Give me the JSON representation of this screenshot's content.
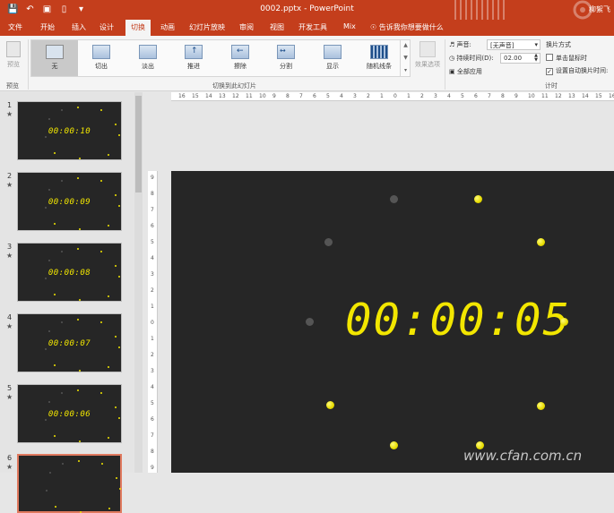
{
  "window": {
    "title": "0002.pptx - PowerPoint",
    "user": "柳絮飞"
  },
  "tabs": [
    {
      "label": "文件",
      "active": false
    },
    {
      "label": "开始",
      "active": false
    },
    {
      "label": "插入",
      "active": false
    },
    {
      "label": "设计",
      "active": false
    },
    {
      "label": "切换",
      "active": true
    },
    {
      "label": "动画",
      "active": false
    },
    {
      "label": "幻灯片放映",
      "active": false
    },
    {
      "label": "审阅",
      "active": false
    },
    {
      "label": "视图",
      "active": false
    },
    {
      "label": "开发工具",
      "active": false
    },
    {
      "label": "Mix",
      "active": false
    }
  ],
  "tell_me": "告诉我你想要做什么",
  "ribbon": {
    "preview_label": "预览",
    "preview_group": "预览",
    "effects": [
      {
        "label": "无",
        "selected": true
      },
      {
        "label": "切出",
        "selected": false
      },
      {
        "label": "淡出",
        "selected": false
      },
      {
        "label": "推进",
        "selected": false
      },
      {
        "label": "擦除",
        "selected": false
      },
      {
        "label": "分割",
        "selected": false
      },
      {
        "label": "显示",
        "selected": false
      },
      {
        "label": "随机线条",
        "selected": false
      }
    ],
    "effect_options": "效果选项",
    "transition_group": "切换到此幻灯片",
    "timing": {
      "sound_label": "声音:",
      "sound_value": "[无声音]",
      "duration_label": "持续时间(D):",
      "duration_value": "02.00",
      "apply_all": "全部应用",
      "advance_title": "换片方式",
      "on_click": "单击鼠标时",
      "on_click_checked": false,
      "after": "设置自动换片时间:",
      "after_checked": true,
      "group": "计时"
    }
  },
  "slides": [
    {
      "number": "1",
      "star": "★",
      "time": "00:00:10"
    },
    {
      "number": "2",
      "star": "★",
      "time": "00:00:09"
    },
    {
      "number": "3",
      "star": "★",
      "time": "00:00:08"
    },
    {
      "number": "4",
      "star": "★",
      "time": "00:00:07"
    },
    {
      "number": "5",
      "star": "★",
      "time": "00:00:06"
    },
    {
      "number": "6",
      "star": "★",
      "time": ""
    }
  ],
  "current_slide": {
    "time": "00:00:05",
    "dots_lit": 7,
    "dots_total": 10
  },
  "ruler": {
    "h_labels": [
      "16",
      "15",
      "14",
      "13",
      "12",
      "11",
      "10",
      "9",
      "8",
      "7",
      "6",
      "5",
      "4",
      "3",
      "2",
      "1",
      "0",
      "1",
      "2",
      "3",
      "4",
      "5",
      "6",
      "7",
      "8",
      "9",
      "10",
      "11",
      "12",
      "13",
      "14",
      "15",
      "16"
    ],
    "v_labels": [
      "9",
      "8",
      "7",
      "6",
      "5",
      "4",
      "3",
      "2",
      "1",
      "0",
      "1",
      "2",
      "3",
      "4",
      "5",
      "6",
      "7",
      "8",
      "9"
    ]
  },
  "watermark": "www.cfan.com.cn",
  "colors": {
    "accent": "#c43e1c",
    "clock": "#f2e600",
    "slide_bg": "#262626",
    "dot_off": "#555555"
  }
}
